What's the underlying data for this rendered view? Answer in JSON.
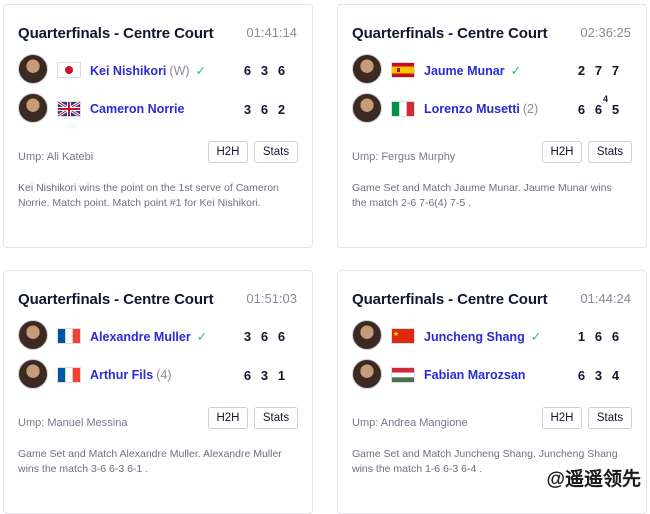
{
  "cards": [
    {
      "title": "Quarterfinals - Centre Court",
      "duration": "01:41:14",
      "p1": {
        "name": "Kei Nishikori",
        "extra": "(W)",
        "winner": true,
        "flag": "japan",
        "scores": [
          "6",
          "3",
          "6"
        ],
        "tb": [
          "",
          "",
          ""
        ]
      },
      "p2": {
        "name": "Cameron Norrie",
        "extra": "",
        "winner": false,
        "flag": "uk",
        "scores": [
          "3",
          "6",
          "2"
        ],
        "tb": [
          "",
          "",
          ""
        ]
      },
      "umpire": "Ump: Ali Katebi",
      "h2h": "H2H",
      "stats": "Stats",
      "description": "Kei Nishikori wins the point on the 1st serve of Cameron Norrie. Match point. Match point #1 for Kei Nishikori."
    },
    {
      "title": "Quarterfinals - Centre Court",
      "duration": "02:36:25",
      "p1": {
        "name": "Jaume Munar",
        "extra": "",
        "winner": true,
        "flag": "spain",
        "scores": [
          "2",
          "7",
          "7"
        ],
        "tb": [
          "",
          "",
          ""
        ]
      },
      "p2": {
        "name": "Lorenzo Musetti",
        "extra": "(2)",
        "winner": false,
        "flag": "italy",
        "scores": [
          "6",
          "6",
          "5"
        ],
        "tb": [
          "",
          "4",
          ""
        ]
      },
      "umpire": "Ump: Fergus Murphy",
      "h2h": "H2H",
      "stats": "Stats",
      "description": "Game Set and Match Jaume Munar. Jaume Munar wins the match 2-6 7-6(4) 7-5 ."
    },
    {
      "title": "Quarterfinals - Centre Court",
      "duration": "01:51:03",
      "p1": {
        "name": "Alexandre Muller",
        "extra": "",
        "winner": true,
        "flag": "france",
        "scores": [
          "3",
          "6",
          "6"
        ],
        "tb": [
          "",
          "",
          ""
        ]
      },
      "p2": {
        "name": "Arthur Fils",
        "extra": "(4)",
        "winner": false,
        "flag": "france",
        "scores": [
          "6",
          "3",
          "1"
        ],
        "tb": [
          "",
          "",
          ""
        ]
      },
      "umpire": "Ump: Manuel Messina",
      "h2h": "H2H",
      "stats": "Stats",
      "description": "Game Set and Match Alexandre Muller. Alexandre Muller wins the match 3-6 6-3 6-1 ."
    },
    {
      "title": "Quarterfinals - Centre Court",
      "duration": "01:44:24",
      "p1": {
        "name": "Juncheng Shang",
        "extra": "",
        "winner": true,
        "flag": "china",
        "scores": [
          "1",
          "6",
          "6"
        ],
        "tb": [
          "",
          "",
          ""
        ]
      },
      "p2": {
        "name": "Fabian Marozsan",
        "extra": "",
        "winner": false,
        "flag": "hungary",
        "scores": [
          "6",
          "3",
          "4"
        ],
        "tb": [
          "",
          "",
          ""
        ]
      },
      "umpire": "Ump: Andrea Mangione",
      "h2h": "H2H",
      "stats": "Stats",
      "description": "Game Set and Match Juncheng Shang. Juncheng Shang wins the match 1-6 6-3 6-4 ."
    }
  ],
  "watermark": "@遥遥领先",
  "colors": {
    "player_link": "#2a2ad8",
    "winner_check": "#22c55e",
    "muted": "#8a8a99"
  }
}
